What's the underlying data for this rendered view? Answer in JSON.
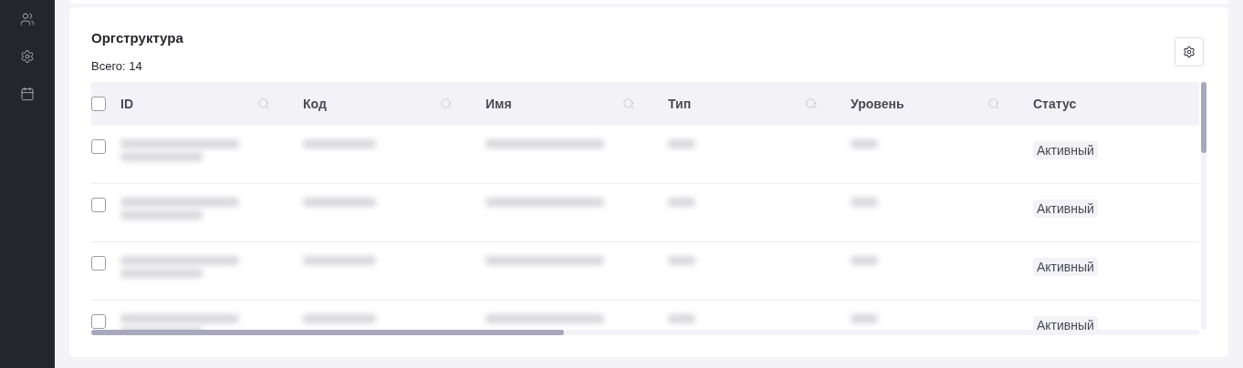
{
  "sidebar": {
    "items": [
      {
        "kind": "people"
      },
      {
        "kind": "settings"
      },
      {
        "kind": "calendar"
      }
    ]
  },
  "card": {
    "title": "Оргструктура",
    "total": "Всего: 14"
  },
  "table": {
    "select_all": {
      "checked": false
    },
    "columns": [
      {
        "label": "ID",
        "searchable": true
      },
      {
        "label": "Код",
        "searchable": true
      },
      {
        "label": "Имя",
        "searchable": true
      },
      {
        "label": "Тип",
        "searchable": true
      },
      {
        "label": "Уровень",
        "searchable": true
      },
      {
        "label": "Статус",
        "searchable": false
      }
    ],
    "rows": [
      {
        "checked": false,
        "status": "Активный"
      },
      {
        "checked": false,
        "status": "Активный"
      },
      {
        "checked": false,
        "status": "Активный"
      },
      {
        "checked": false,
        "status": "Активный"
      }
    ]
  }
}
